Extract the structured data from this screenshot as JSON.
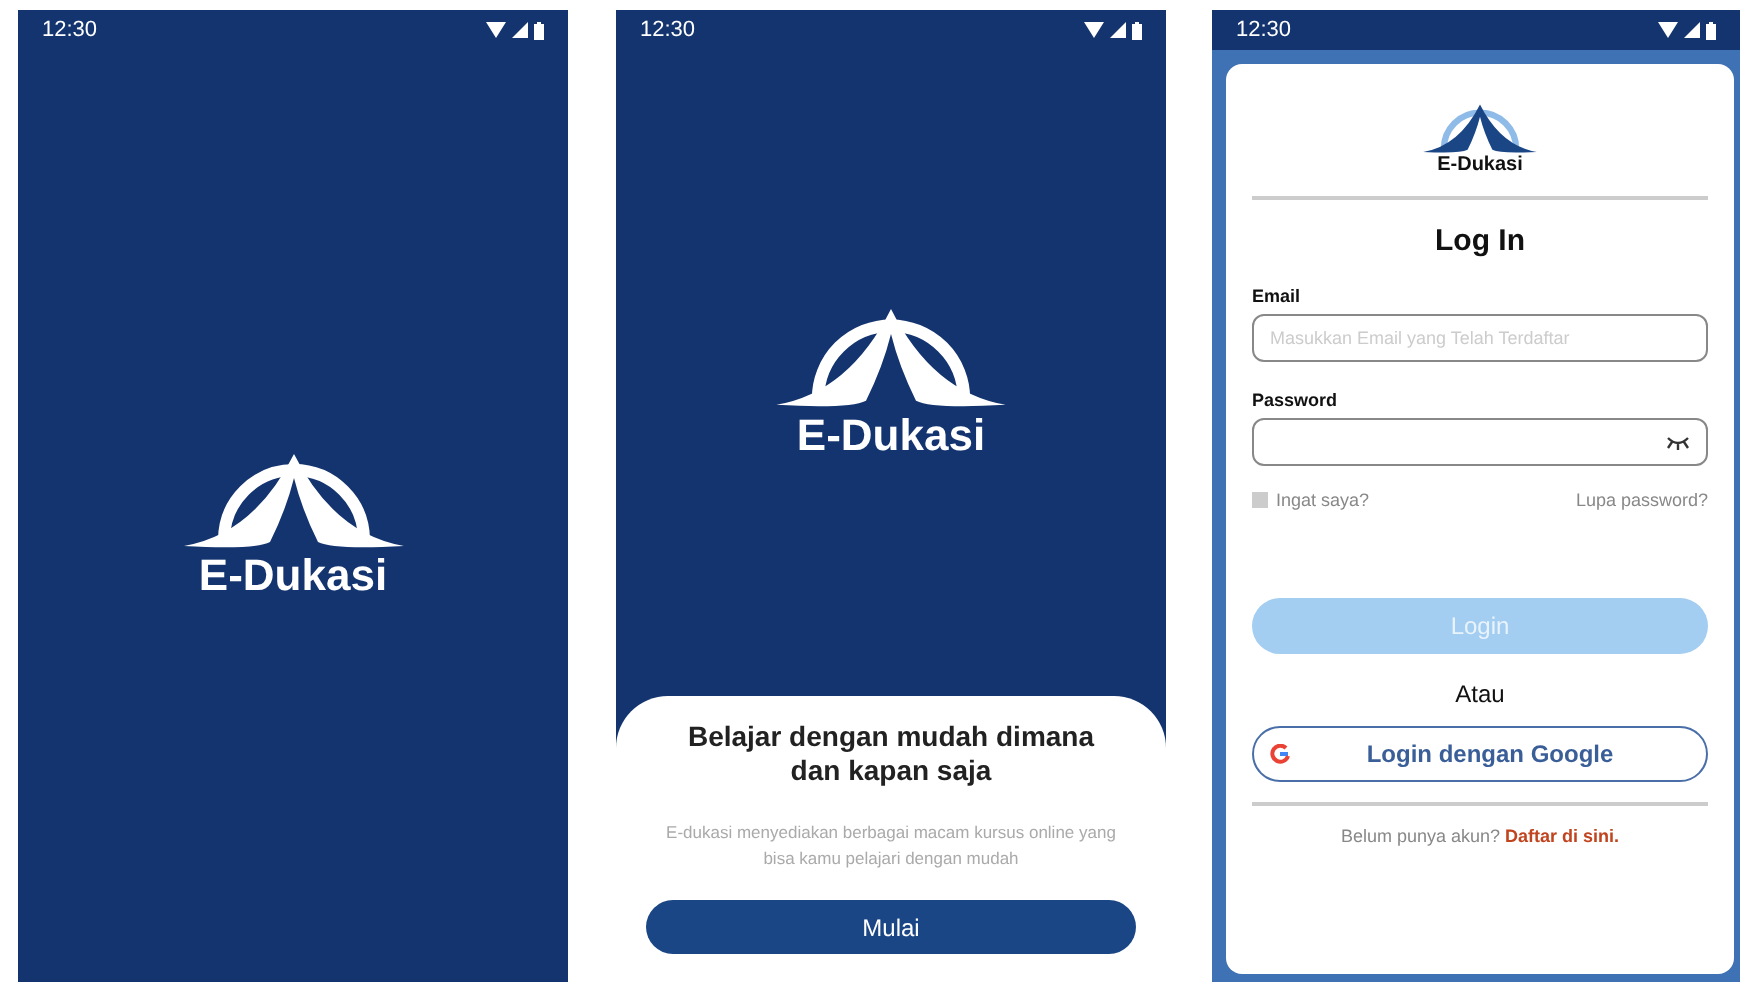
{
  "screens": [
    {
      "kind": "splash",
      "status_bar": {
        "time": "12:30"
      },
      "logo_text": "E-Dukasi"
    },
    {
      "kind": "onboarding",
      "status_bar": {
        "time": "12:30"
      },
      "logo_text": "E-Dukasi",
      "sheet": {
        "title": "Belajar dengan mudah dimana dan kapan saja",
        "description": "E-dukasi menyediakan berbagai macam kursus online yang bisa kamu pelajari dengan mudah",
        "button": "Mulai"
      }
    },
    {
      "kind": "login",
      "status_bar": {
        "time": "12:30"
      },
      "logo_text": "E-Dukasi",
      "title": "Log In",
      "email": {
        "label": "Email",
        "placeholder": "Masukkan Email yang Telah Terdaftar"
      },
      "password": {
        "label": "Password"
      },
      "remember": {
        "label": "Ingat saya?",
        "checked": false
      },
      "forgot": "Lupa password?",
      "login_button": {
        "label": "Login",
        "disabled": true
      },
      "separator": "Atau",
      "google_button": "Login dengan Google",
      "signup": {
        "text": "Belum punya akun?",
        "link": "Daftar di sini."
      }
    }
  ]
}
